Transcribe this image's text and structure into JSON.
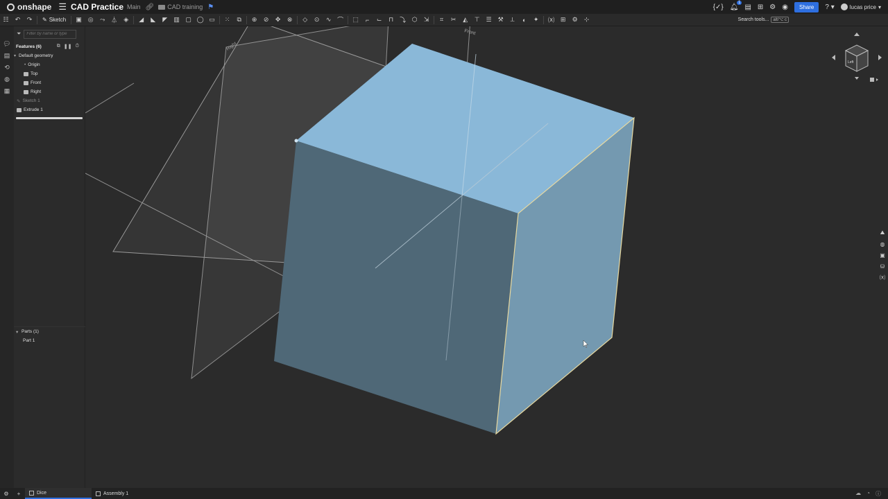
{
  "app": {
    "brand": "onshape",
    "document_title": "CAD Practice",
    "branch": "Main",
    "folder": "CAD training"
  },
  "titlebar": {
    "notifications_count": "1",
    "share_label": "Share",
    "help_label": "?",
    "user_name": "lucas price"
  },
  "toolbar": {
    "sketch_label": "Sketch",
    "search_label": "Search tools...",
    "search_shortcut": "alt/⌥ c"
  },
  "features": {
    "filter_placeholder": "Filter by name or type",
    "header": "Features (6)",
    "default_geometry": "Default geometry",
    "origin": "Origin",
    "planes": [
      "Top",
      "Front",
      "Right"
    ],
    "sketch": "Sketch 1",
    "extrude": "Extrude 1"
  },
  "parts": {
    "header": "Parts (1)",
    "items": [
      "Part 1"
    ]
  },
  "viewport": {
    "plane_labels": [
      "Right",
      "Front"
    ]
  },
  "viewcube": {
    "face_label": "Left"
  },
  "tabs": [
    {
      "label": "Dice",
      "active": true
    },
    {
      "label": "Assembly 1",
      "active": false
    }
  ],
  "colors": {
    "accent": "#2e6fe0",
    "part_face_top": "#8ab8d8",
    "part_face_front": "#4f6877",
    "part_face_right": "#7499b0",
    "viewport_bg": "#2b2b2b"
  }
}
